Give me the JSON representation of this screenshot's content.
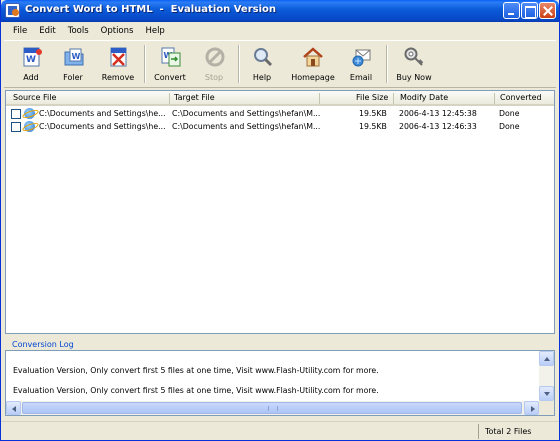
{
  "window": {
    "title": "Convert Word to HTML  -  Evaluation Version"
  },
  "menu": [
    "File",
    "Edit",
    "Tools",
    "Options",
    "Help"
  ],
  "toolbar": {
    "add": "Add",
    "folder": "Foler",
    "remove": "Remove",
    "convert": "Convert",
    "stop": "Stop",
    "help": "Help",
    "homepage": "Homepage",
    "email": "Email",
    "buy_now": "Buy Now"
  },
  "list": {
    "columns": {
      "source": "Source File",
      "target": "Target File",
      "size": "File Size",
      "date": "Modify Date",
      "converted": "Converted"
    },
    "rows": [
      {
        "source": "C:\\Documents and Settings\\he...",
        "target": "C:\\Documents and Settings\\hefan\\M...",
        "size": "19.5KB",
        "date": "2006-4-13 12:45:38",
        "converted": "Done"
      },
      {
        "source": "C:\\Documents and Settings\\he...",
        "target": "C:\\Documents and Settings\\hefan\\M...",
        "size": "19.5KB",
        "date": "2006-4-13 12:46:33",
        "converted": "Done"
      }
    ]
  },
  "log": {
    "label": "Conversion Log",
    "lines": [
      "Evaluation Version, Only convert first 5 files at one time, Visit www.Flash-Utility.com for more.",
      "Evaluation Version, Only convert first 5 files at one time, Visit www.Flash-Utility.com for more."
    ]
  },
  "status": {
    "total": "Total 2 Files"
  }
}
